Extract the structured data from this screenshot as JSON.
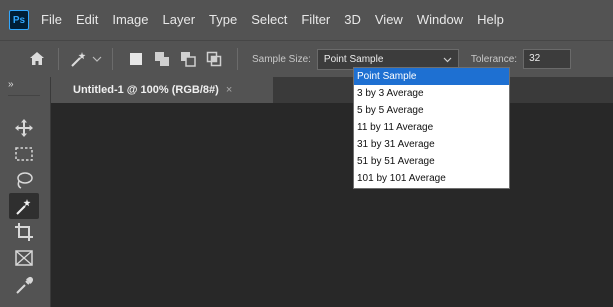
{
  "app": {
    "logo_text": "Ps"
  },
  "menubar": {
    "items": [
      "File",
      "Edit",
      "Image",
      "Layer",
      "Type",
      "Select",
      "Filter",
      "3D",
      "View",
      "Window",
      "Help"
    ]
  },
  "options_bar": {
    "sample_size_label": "Sample Size:",
    "sample_size_value": "Point Sample",
    "tolerance_label": "Tolerance:",
    "tolerance_value": "32"
  },
  "document": {
    "tab_title": "Untitled-1 @ 100% (RGB/8#)",
    "close_glyph": "×"
  },
  "toolbar": {
    "collapse_glyph": "»"
  },
  "dropdown": {
    "options": [
      "Point Sample",
      "3 by 3 Average",
      "5 by 5 Average",
      "11 by 11 Average",
      "31 by 31 Average",
      "51 by 51 Average",
      "101 by 101 Average"
    ],
    "selected": "Point Sample"
  },
  "colors": {
    "menubar_bg": "#535353",
    "canvas_bg": "#282828",
    "highlight": "#1e70d2",
    "ps_logo": "#31a8ff"
  },
  "icons": {
    "home": "home-icon",
    "wand": "magic-wand-icon",
    "tools": [
      "move-icon",
      "marquee-icon",
      "lasso-icon",
      "magic-wand-icon",
      "crop-icon",
      "frame-icon",
      "eyedropper-icon"
    ]
  }
}
